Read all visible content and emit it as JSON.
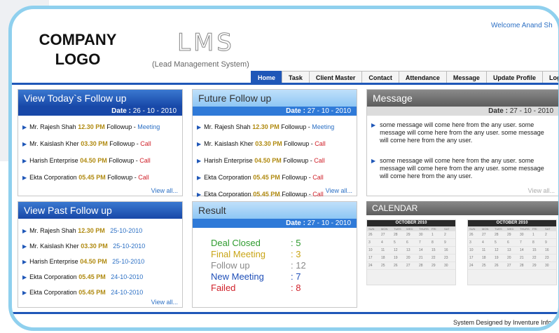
{
  "header": {
    "logo_line1": "COMPANY",
    "logo_line2": "LOGO",
    "app_title": "LMS",
    "app_subtitle": "(Lead Management System)",
    "welcome": "Welcome Anand Sh"
  },
  "nav": [
    "Home",
    "Task",
    "Client Master",
    "Contact",
    "Attendance",
    "Message",
    "Update Profile",
    "Logout"
  ],
  "active_nav": "Home",
  "today": {
    "title": "View Today`s Follow up",
    "date_label": "Date :",
    "date_value": "26 - 10 - 2010",
    "items": [
      {
        "name": "Mr. Rajesh Shah",
        "time": "12.30 PM",
        "prefix": "Followup - ",
        "action": "Meeting",
        "action_type": "meeting"
      },
      {
        "name": "Mr. Kaislash Kher",
        "time": "03.30 PM",
        "prefix": "Followup - ",
        "action": "Call",
        "action_type": "call"
      },
      {
        "name": "Harish Enterprise",
        "time": "04.50 PM",
        "prefix": "Followup - ",
        "action": "Call",
        "action_type": "call"
      },
      {
        "name": "Ekta Corporation",
        "time": "05.45 PM",
        "prefix": "Followup - ",
        "action": "Call",
        "action_type": "call"
      }
    ],
    "view_all": "View all..."
  },
  "future": {
    "title": "Future Follow up",
    "date_label": "Date :",
    "date_value": "27 - 10 - 2010",
    "items": [
      {
        "name": "Mr. Rajesh Shah",
        "time": "12.30 PM",
        "prefix": "Followup - ",
        "action": "Meeting",
        "action_type": "meeting"
      },
      {
        "name": "Mr. Kaislash Kher",
        "time": "03.30 PM",
        "prefix": "Followup - ",
        "action": "Call",
        "action_type": "call"
      },
      {
        "name": "Harish Enterprise",
        "time": "04.50 PM",
        "prefix": "Followup - ",
        "action": "Call",
        "action_type": "call"
      },
      {
        "name": "Ekta Corporation",
        "time": "05.45 PM",
        "prefix": "Followup - ",
        "action": "Call",
        "action_type": "call"
      },
      {
        "name": "Ekta Corporation",
        "time": "05.45 PM",
        "prefix": "Followup - ",
        "action": "Call",
        "action_type": "call"
      }
    ],
    "view_all": "View all..."
  },
  "message": {
    "title": "Message",
    "date_label": "Date :",
    "date_value": "27 - 10 - 2010",
    "items": [
      "some message will come here from the any user. some message will come here from the any user. some message will come here from the any user.",
      "some message will come here from the any user. some message will come here from the any user. some message will come here from the any user."
    ],
    "view_all": "View all..."
  },
  "past": {
    "title": "View Past Follow up",
    "items": [
      {
        "name": "Mr. Rajesh Shah",
        "time": "12.30 PM",
        "date": "25-10-2010"
      },
      {
        "name": "Mr. Kaislash Kher",
        "time": "03.30 PM",
        "date": "25-10-2010"
      },
      {
        "name": "Harish Enterprise",
        "time": "04.50 PM",
        "date": "25-10-2010"
      },
      {
        "name": "Ekta Corporation",
        "time": "05.45 PM",
        "date": "24-10-2010"
      },
      {
        "name": "Ekta Corporation",
        "time": "05.45 PM",
        "date": "24-10-2010"
      }
    ],
    "view_all": "View all..."
  },
  "result": {
    "title": "Result",
    "date_label": "Date :",
    "date_value": "27 - 10 - 2010",
    "items": [
      {
        "label": "Deal Closed",
        "value": ": 5",
        "color": "#2e9b2e"
      },
      {
        "label": "Final Meeting",
        "value": ": 3",
        "color": "#c9a415"
      },
      {
        "label": "Follow up",
        "value": ": 12",
        "color": "#8a8a8a"
      },
      {
        "label": "New Meeting",
        "value": ": 7",
        "color": "#1f4fb8"
      },
      {
        "label": "Failed",
        "value": ": 8",
        "color": "#d0212a"
      }
    ]
  },
  "calendar": {
    "title": "CALENDAR",
    "months": [
      "OCTOBER 2010",
      "OCTOBER 2010"
    ],
    "day_headers": [
      "SUN",
      "MON",
      "TUES",
      "WED",
      "THURS",
      "FRI",
      "SAT"
    ],
    "days": [
      "26",
      "27",
      "28",
      "29",
      "30",
      "1",
      "2",
      "3",
      "4",
      "5",
      "6",
      "7",
      "8",
      "9",
      "10",
      "11",
      "12",
      "13",
      "14",
      "15",
      "16",
      "17",
      "18",
      "19",
      "20",
      "21",
      "22",
      "23",
      "24",
      "25",
      "26",
      "27",
      "28",
      "29",
      "30"
    ]
  },
  "footer": "System Designed by Inventure Info"
}
